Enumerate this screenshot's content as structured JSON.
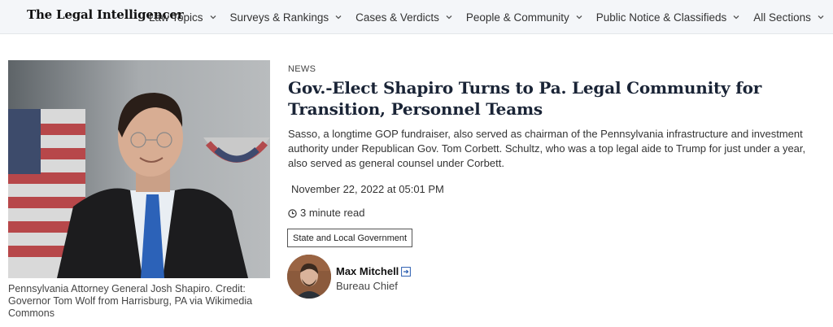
{
  "header": {
    "logo": "The Legal Intelligencer",
    "nav": [
      {
        "label": "Law Topics"
      },
      {
        "label": "Surveys & Rankings"
      },
      {
        "label": "Cases & Verdicts"
      },
      {
        "label": "People & Community"
      },
      {
        "label": "Public Notice & Classifieds"
      },
      {
        "label": "All Sections"
      }
    ]
  },
  "article": {
    "kicker": "NEWS",
    "headline": "Gov.-Elect Shapiro Turns to Pa. Legal Community for Transition, Personnel Teams",
    "summary": "Sasso, a longtime GOP fundraiser, also served as chairman of the Pennsylvania infrastructure and investment authority under Republican Gov. Tom Corbett. Schultz, who was a top legal aide to Trump for just under a year, also served as general counsel under Corbett.",
    "date": "November 22, 2022 at 05:01 PM",
    "read_time": "3 minute read",
    "tag": "State and Local Government",
    "image_caption": "Pennsylvania Attorney General Josh Shapiro. Credit: Governor Tom Wolf from Harrisburg, PA via Wikimedia Commons"
  },
  "author": {
    "name": "Max Mitchell",
    "title": "Bureau Chief"
  },
  "colors": {
    "nav_bg": "#f4f6f9",
    "headline": "#1a2436",
    "link_icon": "#2a5db0"
  }
}
